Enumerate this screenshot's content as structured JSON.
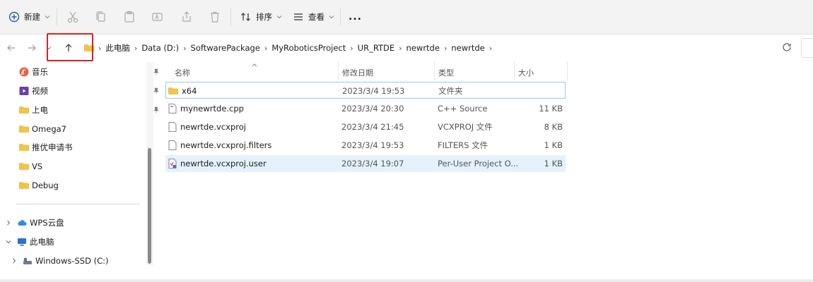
{
  "toolbar": {
    "new_label": "新建",
    "sort_label": "排序",
    "view_label": "查看",
    "more_label": "..."
  },
  "address": {
    "crumbs": [
      "此电脑",
      "Data (D:)",
      "SoftwarePackage",
      "MyRoboticsProject",
      "UR_RTDE",
      "newrtde",
      "newrtde"
    ]
  },
  "sidebar": {
    "quick": [
      {
        "label": "音乐",
        "icon": "music-icon",
        "pinned": true
      },
      {
        "label": "视频",
        "icon": "video-icon",
        "pinned": true
      },
      {
        "label": "上电",
        "icon": "folder-icon",
        "pinned": true
      },
      {
        "label": "Omega7",
        "icon": "folder-icon",
        "pinned": false
      },
      {
        "label": "推优申请书",
        "icon": "folder-icon",
        "pinned": false
      },
      {
        "label": "VS",
        "icon": "folder-icon",
        "pinned": false
      },
      {
        "label": "Debug",
        "icon": "folder-icon",
        "pinned": false
      }
    ],
    "tree": [
      {
        "label": "WPS云盘",
        "icon": "cloud-icon",
        "expanded": false
      },
      {
        "label": "此电脑",
        "icon": "computer-icon",
        "expanded": true
      },
      {
        "label": "Windows-SSD (C:)",
        "icon": "drive-icon",
        "expanded": false
      }
    ]
  },
  "columns": {
    "name": "名称",
    "modified": "修改日期",
    "type": "类型",
    "size": "大小"
  },
  "files": [
    {
      "name": "x64",
      "modified": "2023/3/4 19:53",
      "type": "文件夹",
      "size": "",
      "icon": "folder-icon",
      "state": "focused"
    },
    {
      "name": "mynewrtde.cpp",
      "modified": "2023/3/4 20:30",
      "type": "C++ Source",
      "size": "11 KB",
      "icon": "cpp-file-icon",
      "state": ""
    },
    {
      "name": "newrtde.vcxproj",
      "modified": "2023/3/4 21:45",
      "type": "VCXPROJ 文件",
      "size": "8 KB",
      "icon": "file-icon",
      "state": ""
    },
    {
      "name": "newrtde.vcxproj.filters",
      "modified": "2023/3/4 19:53",
      "type": "FILTERS 文件",
      "size": "1 KB",
      "icon": "file-icon",
      "state": ""
    },
    {
      "name": "newrtde.vcxproj.user",
      "modified": "2023/3/4 19:07",
      "type": "Per-User Project O...",
      "size": "1 KB",
      "icon": "vs-user-file-icon",
      "state": "selected"
    }
  ],
  "colors": {
    "selected_row": "#e5f1fb",
    "focus_border": "#99c8ee",
    "folder": "#f4c542",
    "highlight_box": "#e02020"
  }
}
